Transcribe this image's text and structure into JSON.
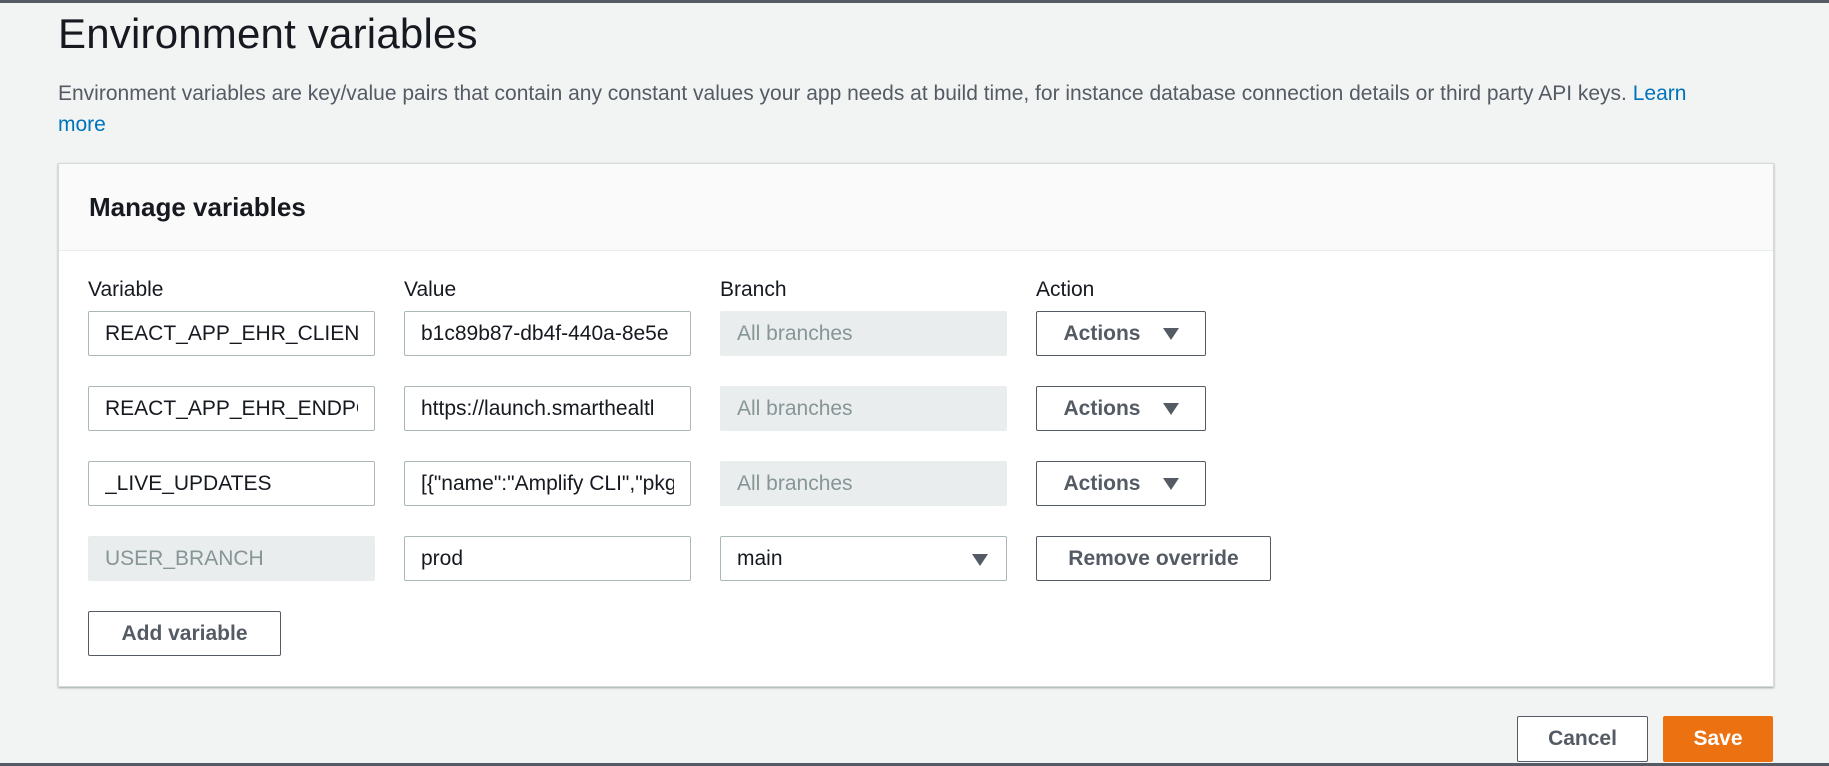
{
  "header": {
    "title": "Environment variables",
    "description": "Environment variables are key/value pairs that contain any constant values your app needs at build time, for instance database connection details or third party API keys.",
    "learn_more": "Learn more"
  },
  "panel": {
    "title": "Manage variables",
    "columns": {
      "variable": "Variable",
      "value": "Value",
      "branch": "Branch",
      "action": "Action"
    },
    "rows": [
      {
        "variable": "REACT_APP_EHR_CLIENT_",
        "value": "b1c89b87-db4f-440a-8e5e",
        "branch": "All branches",
        "action": "Actions"
      },
      {
        "variable": "REACT_APP_EHR_ENDPOII",
        "value": "https://launch.smarthealtl",
        "branch": "All branches",
        "action": "Actions"
      },
      {
        "variable": "_LIVE_UPDATES",
        "value": "[{\"name\":\"Amplify CLI\",\"pkg",
        "branch": "All branches",
        "action": "Actions"
      },
      {
        "variable": "USER_BRANCH",
        "value": "prod",
        "branch": "main",
        "action": "Remove override"
      }
    ],
    "add_variable": "Add variable"
  },
  "footer": {
    "cancel": "Cancel",
    "save": "Save"
  },
  "colors": {
    "primary": "#ec7211",
    "link": "#0073bb",
    "disabled_bg": "#eaeded"
  }
}
